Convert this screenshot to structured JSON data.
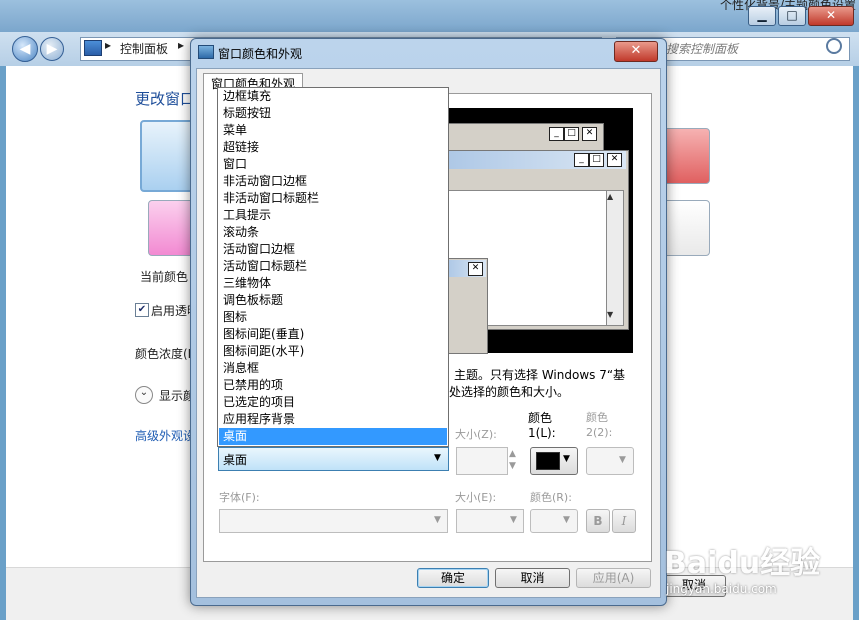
{
  "background_window": {
    "title_partial": "个性化背景/主题颜色设置",
    "breadcrumb": [
      "控制面板"
    ],
    "search_placeholder": "搜索控制面板",
    "heading": "更改窗口",
    "current_color_label": "当前颜色",
    "enable_transparency_label": "启用透明",
    "color_intensity_label": "颜色浓度(I",
    "show_mixer_label": "显示颜",
    "advanced_link": "高级外观设",
    "cancel_label": "取消",
    "min_symbol": "▁",
    "max_symbol": "□",
    "close_symbol": "✕",
    "back_symbol": "◀",
    "forward_symbol": "▶",
    "chevron_symbol": "▸",
    "checkbox_symbol": "✔",
    "expand_symbol": "⌄",
    "swatch_colors": {
      "sky": "#aad0f0",
      "red": "#e06060",
      "pink": "#f28ad2"
    }
  },
  "dialog": {
    "title": "窗口颜色和外观",
    "close_symbol": "✕",
    "tab_label": "窗口颜色和外观",
    "preview": {
      "btn_min": "_",
      "btn_max": "□",
      "btn_close": "✕",
      "scroll_up": "▲",
      "scroll_down": "▼"
    },
    "description_line1": "主题。只有选择 Windows 7“基",
    "description_line2": "处选择的颜色和大小。",
    "item_label_combo_value": "桌面",
    "item_list": [
      "边框填充",
      "标题按钮",
      "菜单",
      "超链接",
      "窗口",
      "非活动窗口边框",
      "非活动窗口标题栏",
      "工具提示",
      "滚动条",
      "活动窗口边框",
      "活动窗口标题栏",
      "三维物体",
      "调色板标题",
      "图标",
      "图标间距(垂直)",
      "图标间距(水平)",
      "消息框",
      "已禁用的项",
      "已选定的项目",
      "应用程序背景",
      "桌面"
    ],
    "selected_item": "桌面",
    "size_label": "大小(Z):",
    "color1_label_line1": "颜色",
    "color1_label_line2": "1(L):",
    "color2_label_line1": "颜色",
    "color2_label_line2": "2(2):",
    "font_label": "字体(F):",
    "font_size_label": "大小(E):",
    "font_color_label": "颜色(R):",
    "bold_label": "B",
    "italic_label": "I",
    "ok_label": "确定",
    "cancel_label": "取消",
    "apply_label": "应用(A)",
    "dropdown_arrow": "▼",
    "spin_up": "▲",
    "spin_down": "▼",
    "color1_value": "#000000"
  },
  "watermark": {
    "brand": "Baidu经验",
    "url": "jingyan.baidu.com"
  }
}
